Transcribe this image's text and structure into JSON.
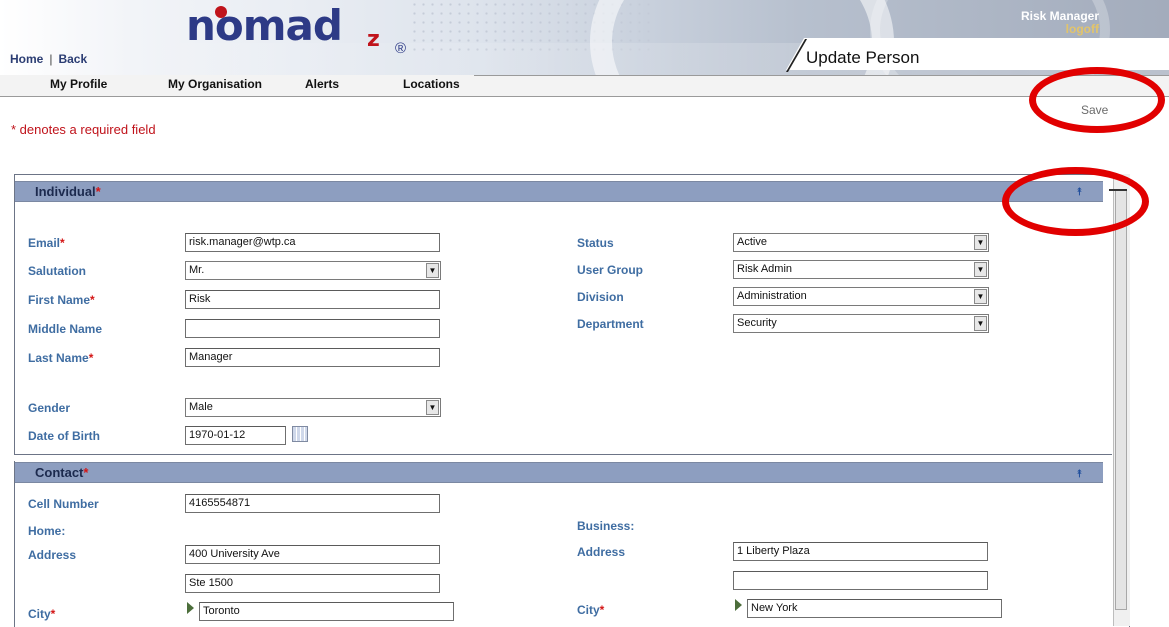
{
  "header": {
    "brand": "nomad",
    "brand_suffix": "z",
    "brand_mark": "®",
    "home_link": "Home",
    "separator": "|",
    "back_link": "Back",
    "user_name": "Risk Manager",
    "logoff": "logoff",
    "page_title": "Update Person"
  },
  "nav": {
    "items": [
      {
        "label": "My Profile"
      },
      {
        "label": "My Organisation"
      },
      {
        "label": "Alerts"
      },
      {
        "label": "Locations"
      }
    ]
  },
  "toolbar": {
    "save_label": "Save"
  },
  "required_note": "* denotes a required field",
  "required_marker": "*",
  "icons": {
    "collapse": "double-chevron-up-icon",
    "calendar": "calendar-icon",
    "select_arrow": "dropdown-arrow-icon",
    "lookup": "triangle-right-icon"
  },
  "individual": {
    "title": "Individual",
    "email": {
      "label": "Email",
      "value": "risk.manager@wtp.ca"
    },
    "salutation": {
      "label": "Salutation",
      "value": "Mr."
    },
    "first_name": {
      "label": "First Name",
      "value": "Risk"
    },
    "middle_name": {
      "label": "Middle Name",
      "value": ""
    },
    "last_name": {
      "label": "Last Name",
      "value": "Manager"
    },
    "gender": {
      "label": "Gender",
      "value": "Male"
    },
    "dob": {
      "label": "Date of Birth",
      "value": "1970-01-12"
    },
    "status": {
      "label": "Status",
      "value": "Active"
    },
    "user_group": {
      "label": "User Group",
      "value": "Risk Admin"
    },
    "division": {
      "label": "Division",
      "value": "Administration"
    },
    "department": {
      "label": "Department",
      "value": "Security"
    }
  },
  "contact": {
    "title": "Contact",
    "cell": {
      "label": "Cell Number",
      "value": "4165554871"
    },
    "home_heading": "Home:",
    "business_heading": "Business:",
    "home_address": {
      "label": "Address",
      "line1": "400 University Ave",
      "line2": "Ste 1500"
    },
    "home_city": {
      "label": "City",
      "value": "Toronto"
    },
    "business_address": {
      "label": "Address",
      "line1": "1 Liberty Plaza",
      "line2": ""
    },
    "business_city": {
      "label": "City",
      "value": "New York"
    }
  },
  "colors": {
    "annotation": "#e10000",
    "section_bar": "#8d9ec0",
    "label_blue": "#3f6da2",
    "required_red": "#c0131b"
  }
}
